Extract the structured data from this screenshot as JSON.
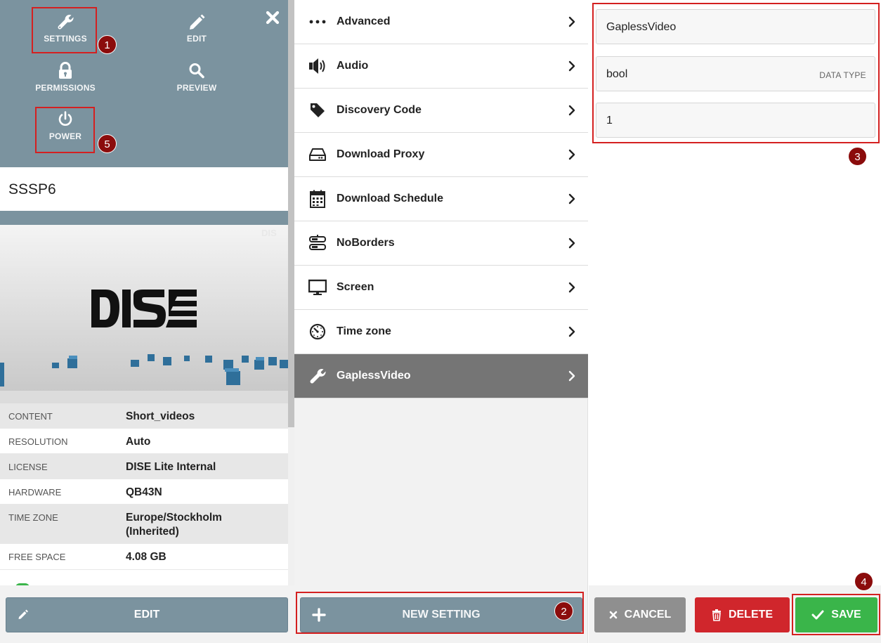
{
  "actions": {
    "settings": "SETTINGS",
    "edit": "EDIT",
    "permissions": "PERMISSIONS",
    "preview": "PREVIEW",
    "power": "POWER"
  },
  "badges": [
    "1",
    "2",
    "3",
    "4",
    "5"
  ],
  "device": {
    "name": "SSSP6",
    "image_logo_text": "DISE",
    "info": [
      {
        "key": "CONTENT",
        "value": "Short_videos"
      },
      {
        "key": "RESOLUTION",
        "value": "Auto"
      },
      {
        "key": "LICENSE",
        "value": "DISE Lite Internal"
      },
      {
        "key": "HARDWARE",
        "value": "QB43N"
      },
      {
        "key": "TIME ZONE",
        "value": "Europe/Stockholm (Inherited)"
      },
      {
        "key": "FREE SPACE",
        "value": "4.08 GB"
      }
    ]
  },
  "left_footer": {
    "edit_label": "EDIT"
  },
  "categories": [
    {
      "label": "Advanced",
      "icon": "ellipsis-icon"
    },
    {
      "label": "Audio",
      "icon": "speaker-icon"
    },
    {
      "label": "Discovery Code",
      "icon": "tag-icon"
    },
    {
      "label": "Download Proxy",
      "icon": "hard-drive-icon"
    },
    {
      "label": "Download Schedule",
      "icon": "calendar-icon"
    },
    {
      "label": "NoBorders",
      "icon": "server-icon"
    },
    {
      "label": "Screen",
      "icon": "monitor-icon"
    },
    {
      "label": "Time zone",
      "icon": "clock-icon"
    },
    {
      "label": "GaplessVideo",
      "icon": "wrench-icon",
      "active": true
    }
  ],
  "new_setting_label": "NEW SETTING",
  "setting_form": {
    "name_value": "GaplessVideo",
    "type_value": "bool",
    "type_suffix": "DATA TYPE",
    "value_value": "1"
  },
  "buttons": {
    "cancel": "CANCEL",
    "delete": "DELETE",
    "save": "SAVE"
  },
  "colors": {
    "slate": "#7b939f",
    "active_row": "#757575",
    "cancel": "#8f8f8f",
    "delete": "#d0262c",
    "save": "#3ab54a",
    "highlight": "#d42020",
    "badge": "#8b0c0c"
  }
}
